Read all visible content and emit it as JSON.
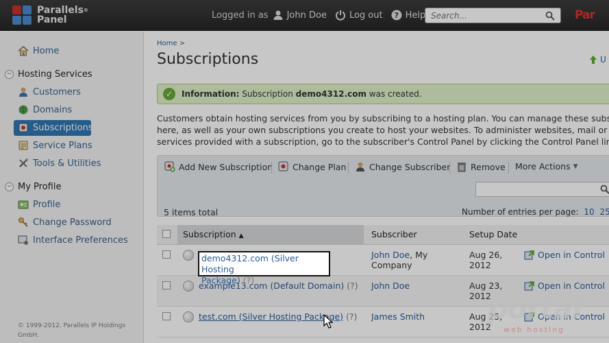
{
  "header": {
    "logo_line1": "Parallels",
    "logo_sup": "®",
    "logo_line2": "Panel",
    "logged_in_as": "Logged in as",
    "user_name": "John Doe",
    "logout": "Log out",
    "help": "Help",
    "search_placeholder": "Search...",
    "brand_right": "Par"
  },
  "sidebar": {
    "home": "Home",
    "hosting_services": "Hosting Services",
    "customers": "Customers",
    "domains": "Domains",
    "subscriptions": "Subscriptions",
    "service_plans": "Service Plans",
    "tools": "Tools & Utilities",
    "my_profile": "My Profile",
    "profile": "Profile",
    "change_password": "Change Password",
    "interface_prefs": "Interface Preferences",
    "copyright_1": "© 1999-2012. Parallels IP Holdings",
    "copyright_2": "GmbH."
  },
  "main": {
    "breadcrumb": "Home",
    "breadcrumb_sep": ">",
    "title": "Subscriptions",
    "up_link": "U",
    "info_label": "Information:",
    "info_pre": "Subscription",
    "info_domain": "demo4312.com",
    "info_post": "was created.",
    "intro_1": "Customers obtain hosting services from you by subscribing to a hosting plan. You can manage these subscription",
    "intro_2": "here, as well as your own subscriptions you create to host your websites. To administer websites, mail or any ot",
    "intro_3": "services provided with a subscription, go to the subscriber's Control Panel by clicking the Control Panel link in th",
    "toolbar": {
      "add": "Add New Subscription",
      "change_plan": "Change Plan",
      "change_subscriber": "Change Subscriber",
      "remove": "Remove",
      "more": "More Actions"
    },
    "total": "5 items total",
    "per_page_label": "Number of entries per page:",
    "per_page_opts": [
      "10",
      "25",
      "1"
    ],
    "columns": {
      "subscription": "Subscription",
      "subscriber": "Subscriber",
      "setup_date": "Setup Date"
    },
    "rows": [
      {
        "domain": "demo4312.com (Silver Hosting",
        "plan_tail": "Package)",
        "q": "(?)",
        "subscriber_1": "John Doe",
        "subscriber_2": ", My",
        "subscriber_3": "Company",
        "date_1": "Aug 26,",
        "date_2": "2012",
        "open": "Open in Control"
      },
      {
        "domain": "example13.com (Default Domain)",
        "q": "(?)",
        "subscriber_1": "John Doe",
        "date_1": "Aug 23,",
        "date_2": "2012",
        "open": "Open in Control"
      },
      {
        "domain": "test.com (Silver Hosting Package)",
        "q": "(?)",
        "subscriber_1": "James Smith",
        "date_1": "Aug 25,",
        "date_2": "2012",
        "open": "Open in Control"
      }
    ]
  },
  "watermark": {
    "main": "portal",
    "sub": "web hosting"
  },
  "colors": {
    "accent": "#2f77b4",
    "link": "#2a5c9a",
    "info_bg": "#dff0c8"
  }
}
